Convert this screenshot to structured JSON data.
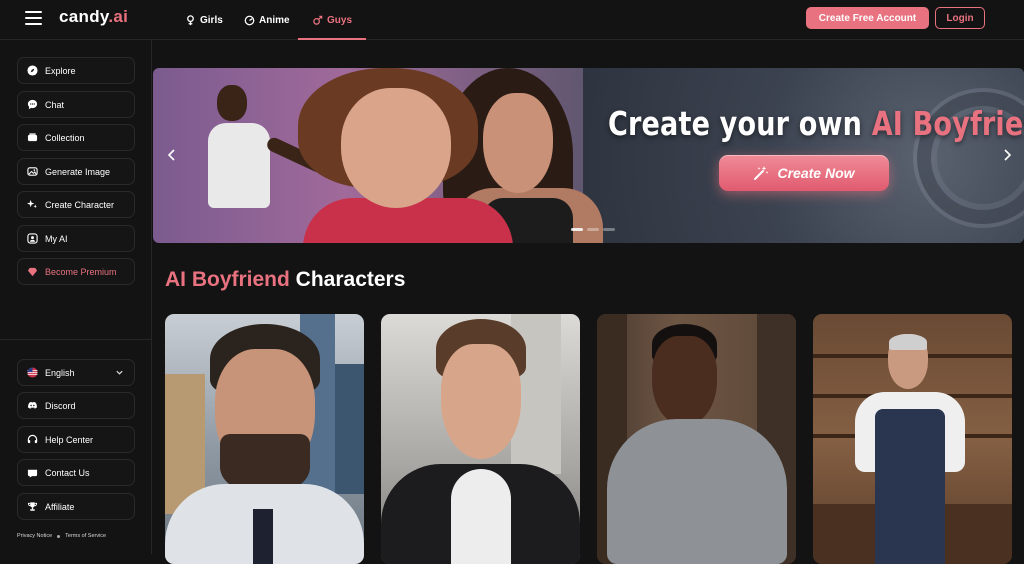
{
  "brand": {
    "name_main": "candy",
    "name_suffix": ".ai"
  },
  "nav": {
    "tabs": [
      {
        "label": "Girls",
        "icon": "female-icon",
        "active": false
      },
      {
        "label": "Anime",
        "icon": "anime-icon",
        "active": false
      },
      {
        "label": "Guys",
        "icon": "male-icon",
        "active": true
      }
    ],
    "create_account_label": "Create Free Account",
    "login_label": "Login"
  },
  "sidebar": {
    "items": [
      {
        "label": "Explore",
        "icon": "compass-icon"
      },
      {
        "label": "Chat",
        "icon": "chat-icon"
      },
      {
        "label": "Collection",
        "icon": "collection-icon"
      },
      {
        "label": "Generate Image",
        "icon": "image-icon"
      },
      {
        "label": "Create Character",
        "icon": "sparkle-icon"
      },
      {
        "label": "My AI",
        "icon": "user-icon"
      },
      {
        "label": "Become Premium",
        "icon": "diamond-icon"
      }
    ],
    "bottom": [
      {
        "label": "English",
        "icon": "flag-icon"
      },
      {
        "label": "Discord",
        "icon": "discord-icon"
      },
      {
        "label": "Help Center",
        "icon": "help-icon"
      },
      {
        "label": "Contact Us",
        "icon": "mail-icon"
      },
      {
        "label": "Affiliate",
        "icon": "trophy-icon"
      }
    ],
    "legal": {
      "privacy": "Privacy Notice",
      "terms": "Terms of Service"
    }
  },
  "hero": {
    "title_main": "Create your own ",
    "title_highlight": "AI Boyfriend",
    "cta_label": "Create Now"
  },
  "section": {
    "title_highlight": "AI Boyfriend",
    "title_rest": " Characters"
  },
  "colors": {
    "accent": "#e8727f",
    "background": "#131313"
  }
}
